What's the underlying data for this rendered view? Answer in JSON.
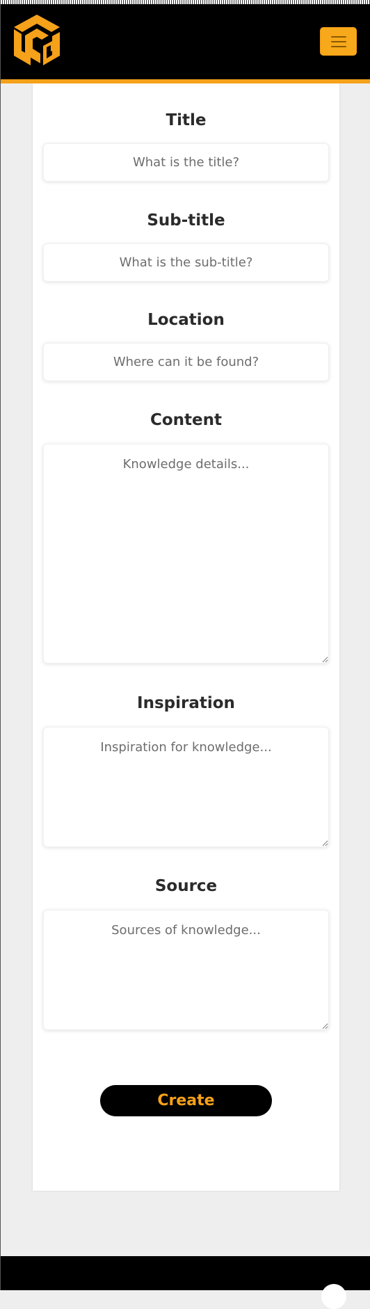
{
  "header": {
    "logo_name": "cg-cube-logo",
    "menu_icon": "hamburger-icon",
    "brand_color": "#f6a11a"
  },
  "form": {
    "title": {
      "label": "Title",
      "placeholder": "What is the title?"
    },
    "subtitle": {
      "label": "Sub-title",
      "placeholder": "What is the sub-title?"
    },
    "location": {
      "label": "Location",
      "placeholder": "Where can it be found?"
    },
    "content": {
      "label": "Content",
      "placeholder": "Knowledge details..."
    },
    "inspiration": {
      "label": "Inspiration",
      "placeholder": "Inspiration for knowledge..."
    },
    "source": {
      "label": "Source",
      "placeholder": "Sources of knowledge..."
    },
    "submit_label": "Create"
  },
  "footer": {
    "chat_icon": "chat-bubble-icon"
  }
}
